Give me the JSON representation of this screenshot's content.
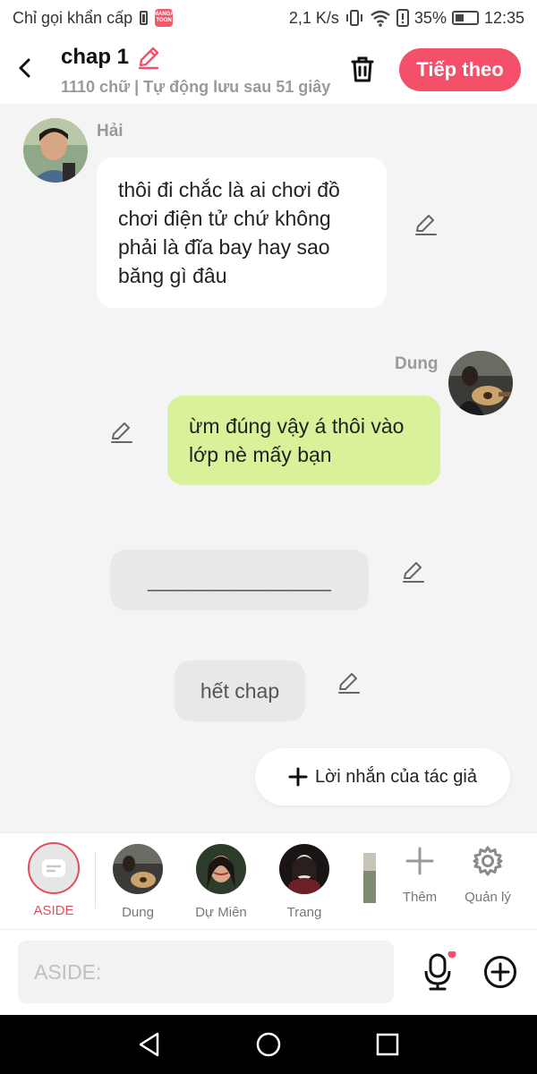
{
  "status_bar": {
    "carrier_text": "Chỉ gọi khẩn cấp",
    "app_badge_text": "MANGA TOON",
    "net_speed": "2,1 K/s",
    "battery": "35%",
    "time": "12:35"
  },
  "header": {
    "title": "chap 1",
    "subtitle": "1110 chữ | Tự động lưu sau 51 giây",
    "next_label": "Tiếp theo",
    "accent_color": "#f5506a"
  },
  "messages": [
    {
      "sender": "Hải",
      "side": "left",
      "text": "thôi đi chắc là ai chơi đồ chơi điện tử chứ không phải là đĩa bay hay sao băng gì đâu"
    },
    {
      "sender": "Dung",
      "side": "right",
      "text": "ừm đúng vậy á thôi vào lớp nè mấy bạn"
    },
    {
      "text": "________________"
    },
    {
      "text": "hết chap"
    }
  ],
  "author_note_label": "Lời nhắn của tác giả",
  "characters": {
    "aside_label": "ASIDE",
    "items": [
      {
        "name": "Dung"
      },
      {
        "name": "Dự Miên"
      },
      {
        "name": "Trang"
      }
    ],
    "add_label": "Thêm",
    "manage_label": "Quản lý"
  },
  "composer": {
    "placeholder": "ASIDE:"
  },
  "icons": {
    "back": "back-arrow-icon",
    "edit": "pencil-icon",
    "delete": "trash-icon",
    "mic": "microphone-icon",
    "add": "plus-circle-icon",
    "settings": "gear-icon"
  }
}
